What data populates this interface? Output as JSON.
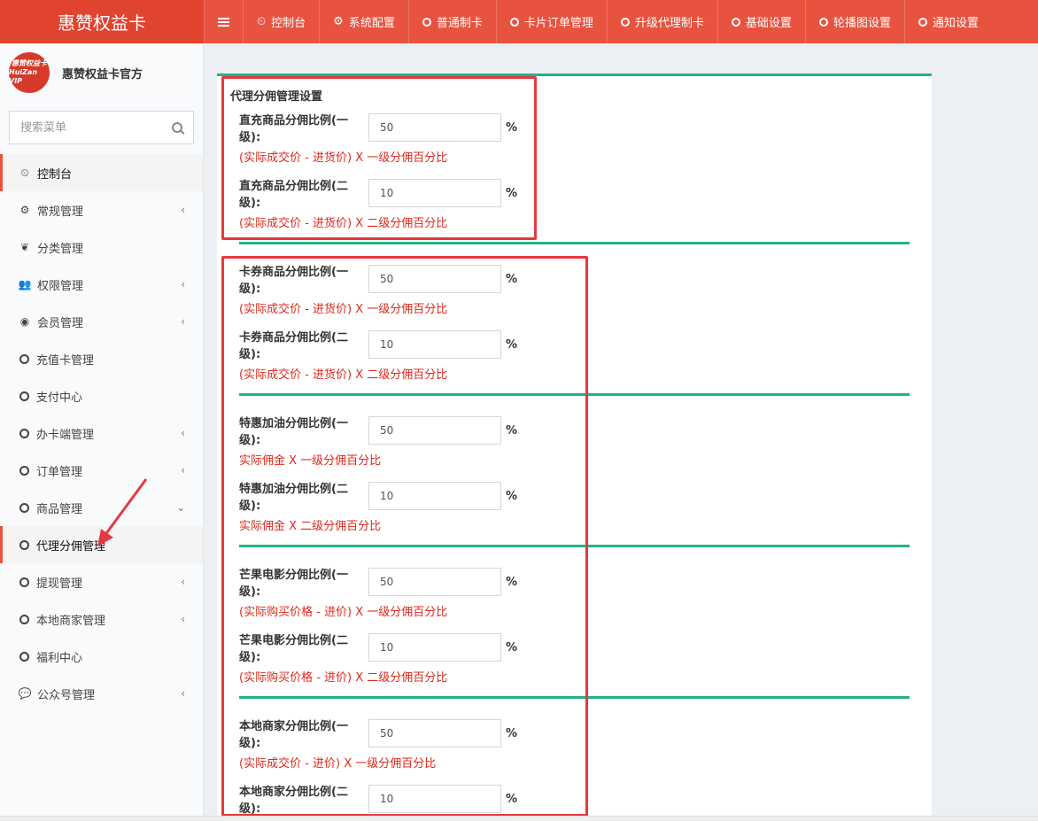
{
  "app": {
    "title": "惠赞权益卡"
  },
  "topnav": [
    {
      "label": "",
      "icon": "hamburger-icon"
    },
    {
      "label": "控制台",
      "icon": "dashboard-icon"
    },
    {
      "label": "系统配置",
      "icon": "gear-icon"
    },
    {
      "label": "普通制卡",
      "icon": "circle-icon"
    },
    {
      "label": "卡片订单管理",
      "icon": "circle-icon"
    },
    {
      "label": "升级代理制卡",
      "icon": "circle-icon"
    },
    {
      "label": "基础设置",
      "icon": "circle-icon"
    },
    {
      "label": "轮播图设置",
      "icon": "circle-icon"
    },
    {
      "label": "通知设置",
      "icon": "circle-icon"
    }
  ],
  "user": {
    "name": "惠赞权益卡官方",
    "avatar_line1": "惠赞权益卡",
    "avatar_line2": "HuiZan VIP"
  },
  "search": {
    "placeholder": "搜索菜单"
  },
  "sidebar": {
    "items": [
      {
        "label": "控制台",
        "icon": "dashboard-icon",
        "chevron": ""
      },
      {
        "label": "常规管理",
        "icon": "cogs-icon",
        "chevron": "‹"
      },
      {
        "label": "分类管理",
        "icon": "leaf-icon",
        "chevron": ""
      },
      {
        "label": "权限管理",
        "icon": "users-icon",
        "chevron": "‹"
      },
      {
        "label": "会员管理",
        "icon": "user-circle-icon",
        "chevron": "‹"
      },
      {
        "label": "充值卡管理",
        "icon": "circle-icon",
        "chevron": ""
      },
      {
        "label": "支付中心",
        "icon": "circle-icon",
        "chevron": ""
      },
      {
        "label": "办卡端管理",
        "icon": "circle-icon",
        "chevron": "‹"
      },
      {
        "label": "订单管理",
        "icon": "circle-icon",
        "chevron": "‹"
      },
      {
        "label": "商品管理",
        "icon": "circle-icon",
        "chevron": "⌄"
      },
      {
        "label": "代理分佣管理",
        "icon": "circle-icon",
        "chevron": ""
      },
      {
        "label": "提现管理",
        "icon": "circle-icon",
        "chevron": "‹"
      },
      {
        "label": "本地商家管理",
        "icon": "circle-icon",
        "chevron": "‹"
      },
      {
        "label": "福利中心",
        "icon": "circle-icon",
        "chevron": ""
      },
      {
        "label": "公众号管理",
        "icon": "wechat-icon",
        "chevron": "‹"
      }
    ]
  },
  "main": {
    "section_title": "代理分佣管理设置",
    "percent_sign": "%",
    "fields": [
      {
        "label": "直充商品分佣比例(一级):",
        "value": "50",
        "hint": "(实际成交价 - 进货价) X 一级分佣百分比"
      },
      {
        "label": "直充商品分佣比例(二级):",
        "value": "10",
        "hint": "(实际成交价 - 进货价) X 二级分佣百分比"
      },
      {
        "label": "卡券商品分佣比例(一级):",
        "value": "50",
        "hint": "(实际成交价 - 进货价) X 一级分佣百分比"
      },
      {
        "label": "卡券商品分佣比例(二级):",
        "value": "10",
        "hint": "(实际成交价 - 进货价) X 二级分佣百分比"
      },
      {
        "label": "特惠加油分佣比例(一级):",
        "value": "50",
        "hint": "实际佣金 X 一级分佣百分比"
      },
      {
        "label": "特惠加油分佣比例(二级):",
        "value": "10",
        "hint": "实际佣金 X 二级分佣百分比"
      },
      {
        "label": "芒果电影分佣比例(一级):",
        "value": "50",
        "hint": "(实际购买价格 - 进价) X 一级分佣百分比"
      },
      {
        "label": "芒果电影分佣比例(二级):",
        "value": "10",
        "hint": "(实际购买价格 - 进价) X 二级分佣百分比"
      },
      {
        "label": "本地商家分佣比例(一级):",
        "value": "50",
        "hint": "(实际成交价 - 进价) X 一级分佣百分比"
      },
      {
        "label": "本地商家分佣比例(二级):",
        "value": "10",
        "hint": ""
      }
    ]
  },
  "colors": {
    "header": "#e8533f",
    "accent_line": "#22b189",
    "hint_red": "#e0281c",
    "annotation_red": "#e5393f"
  }
}
